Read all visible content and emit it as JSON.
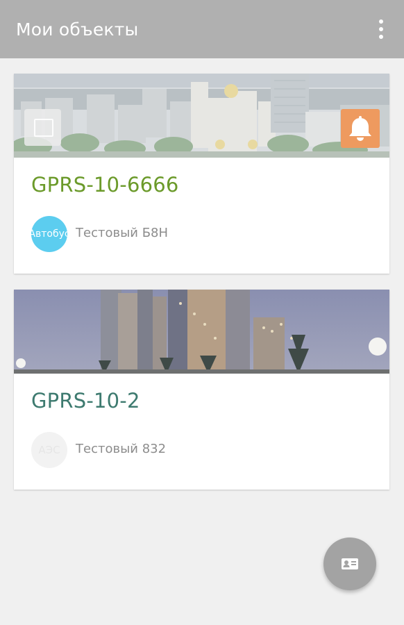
{
  "appbar": {
    "title": "Мои объекты",
    "menu_icon": "more-vertical-icon"
  },
  "objects": [
    {
      "name": "GPRS-10-6666",
      "avatar_text": "Автобус",
      "description": "Тестовый Б8Н",
      "banner": "city-day-photo",
      "has_camera_icon": true,
      "has_alarm_badge": true,
      "name_color": "#6b9a2a",
      "avatar_color": "#5ccdef",
      "alarm_color": "#ee9a5f"
    },
    {
      "name": "GPRS-10-2",
      "avatar_text": "АЭС",
      "description": "Тестовый 832",
      "banner": "city-night-photo",
      "name_color": "#3d7a6f",
      "avatar_color": "#f2f2f2"
    }
  ],
  "fab": {
    "icon": "contact-card-icon",
    "color": "#a3a3a3"
  },
  "colors": {
    "appbar": "#b0b0b0",
    "background": "#f0f0f0"
  }
}
